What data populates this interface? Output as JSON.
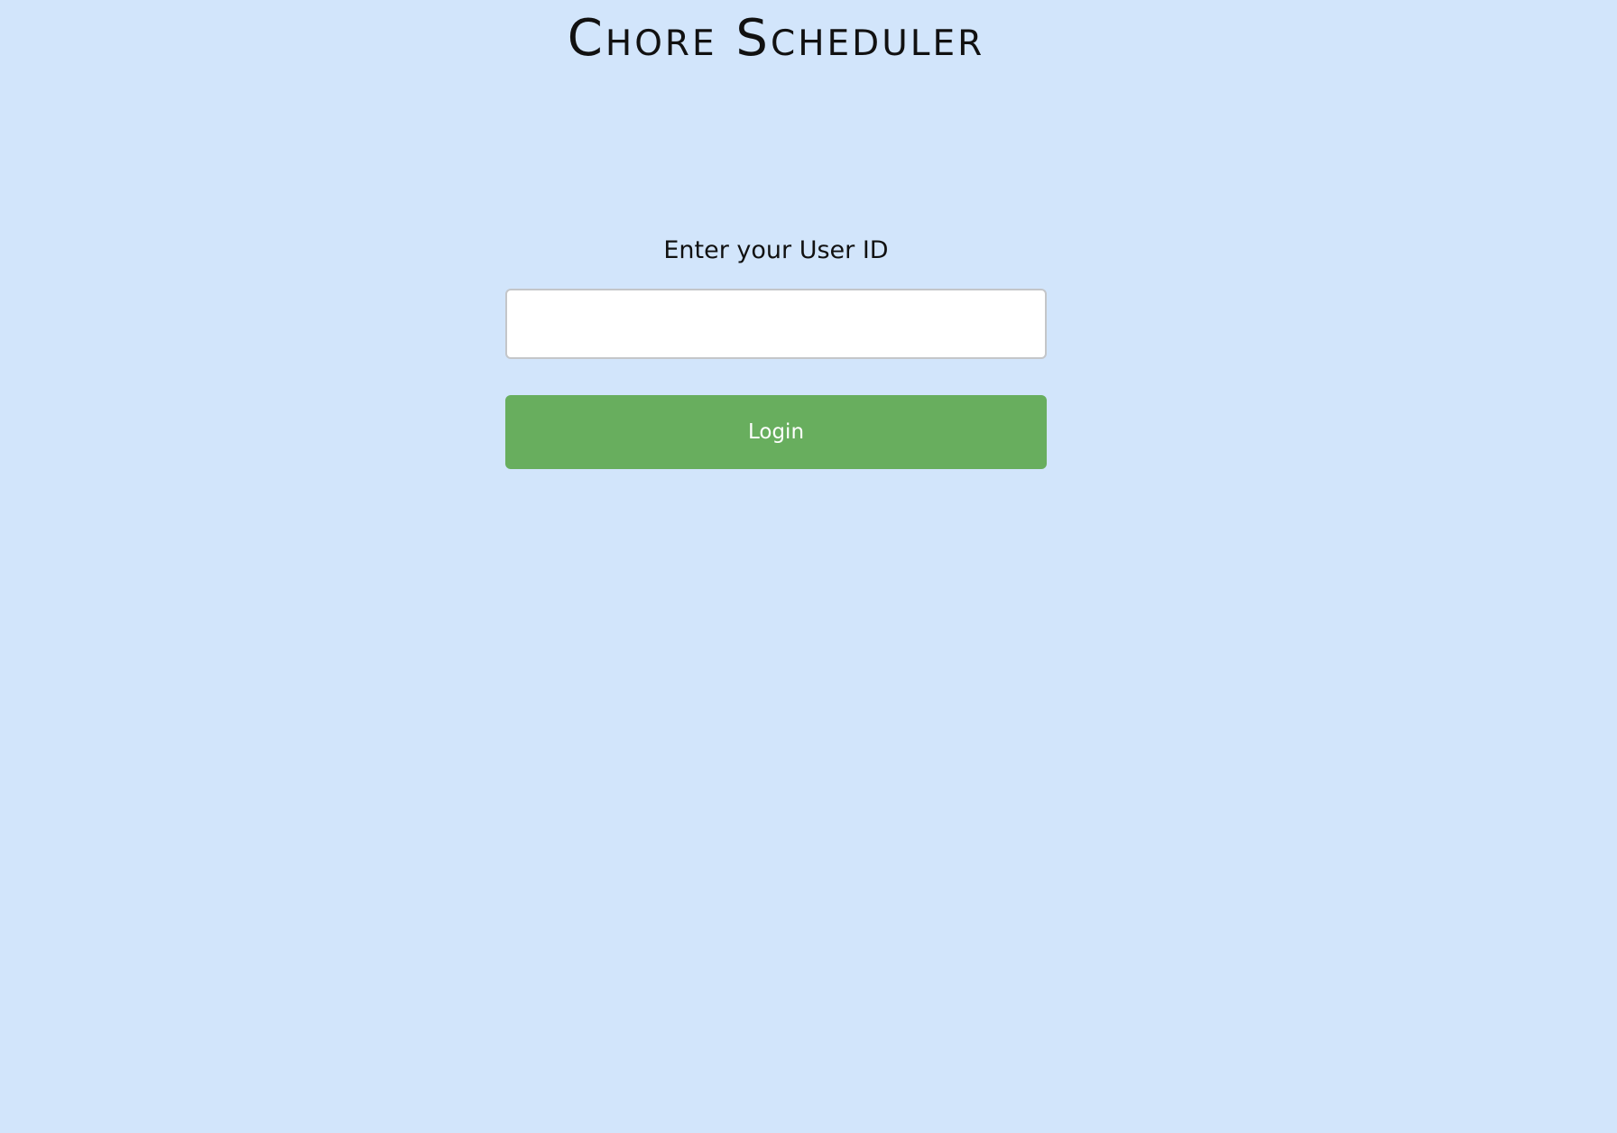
{
  "app": {
    "title": "Chore Scheduler"
  },
  "login": {
    "prompt": "Enter your User ID",
    "user_id_value": "",
    "user_id_placeholder": "",
    "button_label": "Login"
  },
  "colors": {
    "background": "#d2e5fb",
    "button": "#68ae5e",
    "button_text": "#ffffff",
    "input_border": "#c4c6c9"
  }
}
